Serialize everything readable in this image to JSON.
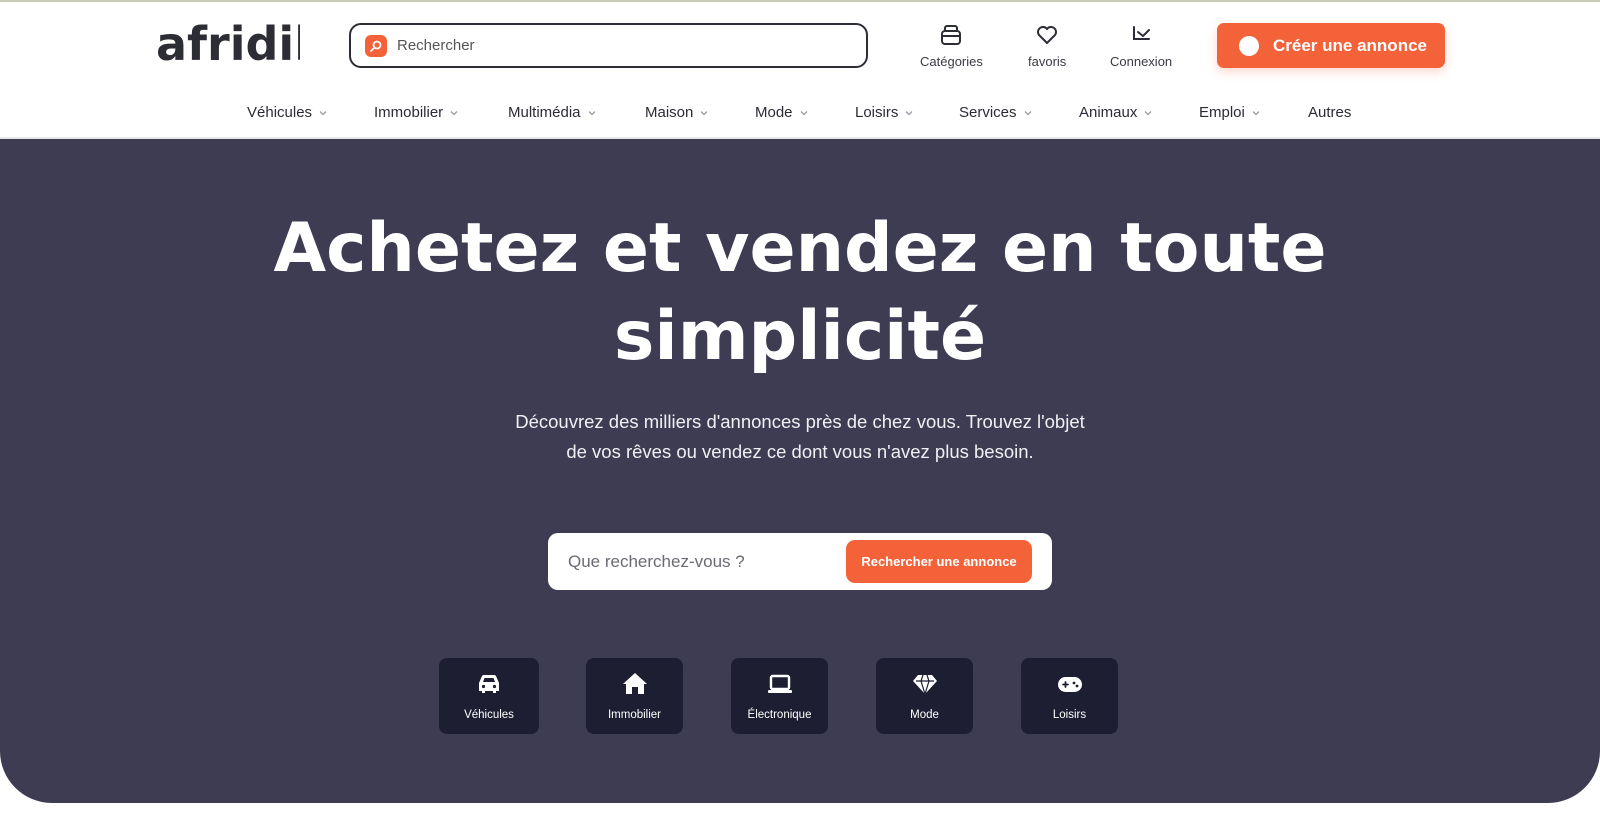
{
  "brand": {
    "logo_text": "afridil",
    "accent_color": "#f4623a",
    "hero_bg_color": "#3d3c52",
    "tile_bg_color": "#1e1e33"
  },
  "header": {
    "search_placeholder": "Rechercher",
    "links": [
      {
        "label": "Catégories",
        "icon": "categories-icon"
      },
      {
        "label": "favoris",
        "icon": "heart-icon"
      },
      {
        "label": "Connexion",
        "icon": "login-icon"
      }
    ],
    "create_button": "Créer une annonce"
  },
  "nav": {
    "items": [
      {
        "label": "Véhicules",
        "has_dropdown": true
      },
      {
        "label": "Immobilier",
        "has_dropdown": true
      },
      {
        "label": "Multimédia",
        "has_dropdown": true
      },
      {
        "label": "Maison",
        "has_dropdown": true
      },
      {
        "label": "Mode",
        "has_dropdown": true
      },
      {
        "label": "Loisirs",
        "has_dropdown": true
      },
      {
        "label": "Services",
        "has_dropdown": true
      },
      {
        "label": "Animaux",
        "has_dropdown": true
      },
      {
        "label": "Emploi",
        "has_dropdown": true
      },
      {
        "label": "Autres",
        "has_dropdown": false
      }
    ]
  },
  "hero": {
    "title_line1": "Achetez et vendez en toute",
    "title_line2": "simplicité",
    "subtitle_line1": "Découvrez des milliers d'annonces près de chez vous. Trouvez l'objet",
    "subtitle_line2": "de vos rêves ou vendez ce dont vous n'avez plus besoin.",
    "search_placeholder": "Que recherchez-vous ?",
    "search_button": "Rechercher une annonce",
    "categories": [
      {
        "label": "Véhicules",
        "icon": "car-icon"
      },
      {
        "label": "Immobilier",
        "icon": "house-icon"
      },
      {
        "label": "Électronique",
        "icon": "laptop-icon"
      },
      {
        "label": "Mode",
        "icon": "gem-icon"
      },
      {
        "label": "Loisirs",
        "icon": "gamepad-icon"
      }
    ]
  }
}
